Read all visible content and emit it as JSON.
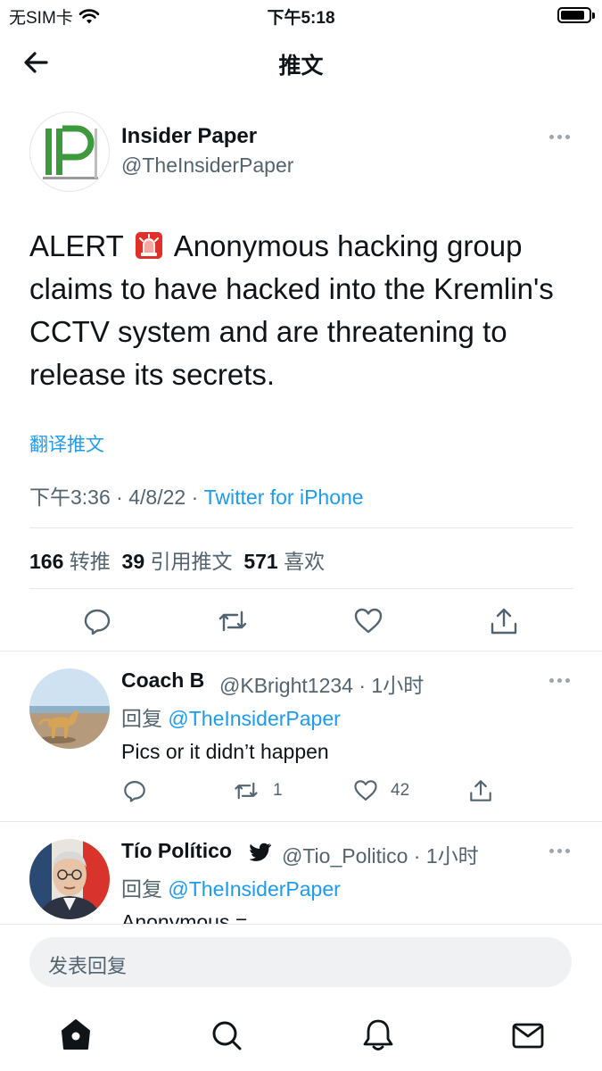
{
  "status_bar": {
    "carrier": "无SIM卡",
    "time": "下午5:18",
    "battery_level": 0.85
  },
  "nav": {
    "title": "推文",
    "back_icon": "arrow-left-icon"
  },
  "tweet": {
    "author_name": "Insider Paper",
    "author_handle": "@TheInsiderPaper",
    "avatar_logo_text": "IP",
    "text_before_emoji": "ALERT",
    "emoji": "siren-icon",
    "text_after_emoji": "Anonymous hacking group claims to have hacked into the Kremlin's CCTV system and are threatening to release its secrets.",
    "translate_label": "翻译推文",
    "time": "下午3:36",
    "date": "4/8/22",
    "separator": "·",
    "source": "Twitter for iPhone",
    "stats": {
      "retweets": "166",
      "retweets_label": "转推",
      "quotes": "39",
      "quotes_label": "引用推文",
      "likes": "571",
      "likes_label": "喜欢"
    },
    "actions": [
      "reply-icon",
      "retweet-icon",
      "like-icon",
      "share-icon"
    ]
  },
  "replies": [
    {
      "name": "Coach B",
      "handle": "@KBright1234",
      "separator": "·",
      "time": "1小时",
      "reply_prefix": "回复",
      "reply_to": "@TheInsiderPaper",
      "text": "Pics or it didn’t happen",
      "retweet_count": "1",
      "like_count": "42"
    },
    {
      "name": "Tío Político",
      "verified_icon": "bird-icon",
      "handle": "@Tio_Politico",
      "separator": "·",
      "time": "1小时",
      "reply_prefix": "回复",
      "reply_to": "@TheInsiderPaper",
      "text": "Anonymous ="
    }
  ],
  "compose": {
    "placeholder": "发表回复"
  },
  "tab_bar": [
    "home-icon",
    "search-icon",
    "notifications-icon",
    "messages-icon"
  ],
  "colors": {
    "accent": "#1d9bf0",
    "secondary_text": "#536471",
    "logo_green": "#3c9a3c"
  }
}
